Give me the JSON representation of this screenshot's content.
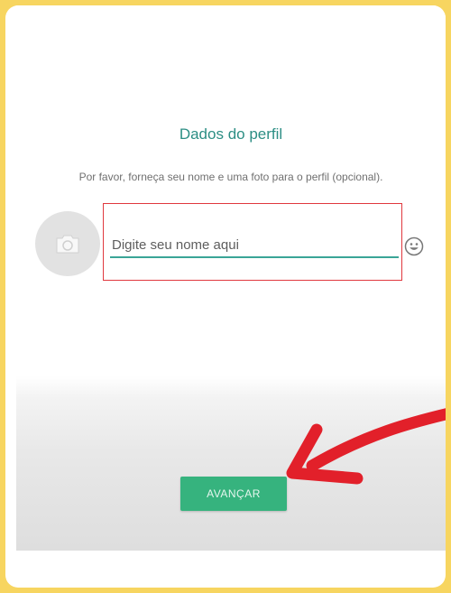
{
  "profile": {
    "title": "Dados do perfil",
    "subtitle": "Por favor, forneça seu nome e uma foto para o perfil (opcional).",
    "name_placeholder": "Digite seu nome aqui",
    "name_value": ""
  },
  "icons": {
    "photo": "camera-icon",
    "emoji": "smiley-emoji-icon",
    "annotation": "red-arrow"
  },
  "actions": {
    "advance_label": "AVANÇAR"
  },
  "colors": {
    "background": "#f7d560",
    "title_teal": "#2c8e84",
    "input_underline": "#3aa597",
    "button_green": "#36b37e",
    "highlight_red": "#e0383e",
    "arrow_red": "#e2202a"
  }
}
